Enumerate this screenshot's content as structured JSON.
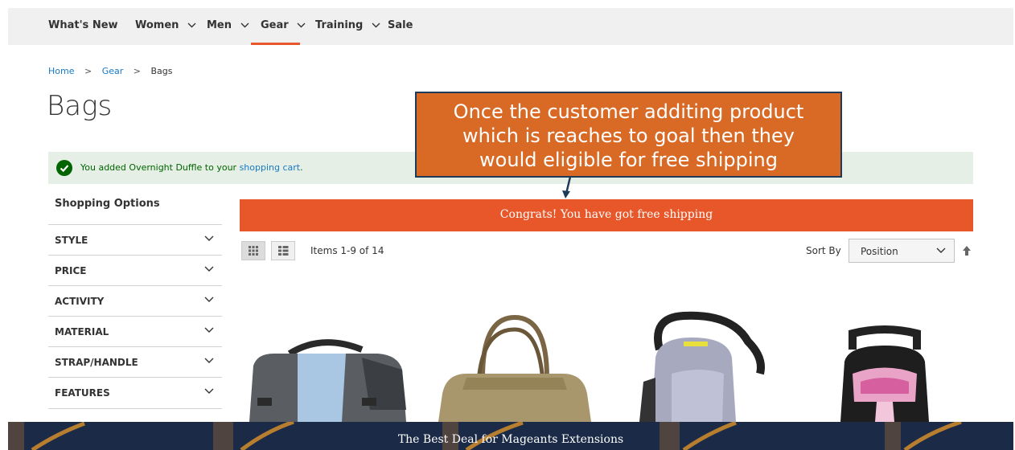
{
  "nav": {
    "items": [
      {
        "label": "What's New",
        "dropdown": false
      },
      {
        "label": "Women",
        "dropdown": true
      },
      {
        "label": "Men",
        "dropdown": true
      },
      {
        "label": "Gear",
        "dropdown": true,
        "active": true
      },
      {
        "label": "Training",
        "dropdown": true
      },
      {
        "label": "Sale",
        "dropdown": false
      }
    ]
  },
  "breadcrumb": {
    "home": "Home",
    "gear": "Gear",
    "current": "Bags",
    "separator": ">"
  },
  "page": {
    "title": "Bags"
  },
  "message": {
    "text_before": "You added Overnight Duffle to your ",
    "link": "shopping cart",
    "text_after": "."
  },
  "callout": {
    "lines": [
      "Once the customer additing product",
      "which is reaches to goal then they",
      "would eligible for free shipping"
    ]
  },
  "shipping_bar": {
    "text": "Congrats! You have got free shipping"
  },
  "sidebar": {
    "title": "Shopping Options",
    "filters": [
      "STYLE",
      "PRICE",
      "ACTIVITY",
      "MATERIAL",
      "STRAP/HANDLE",
      "FEATURES"
    ]
  },
  "toolbar": {
    "items_count": "Items 1-9 of 14",
    "sort_label": "Sort By",
    "sort_value": "Position"
  },
  "banner": {
    "text": "The Best Deal for Mageants Extensions"
  },
  "colors": {
    "accent": "#e8572a",
    "callout": "#d96a26",
    "success_bg": "#e5efe5",
    "link": "#1979c3",
    "banner_bg": "#1b2a46"
  }
}
